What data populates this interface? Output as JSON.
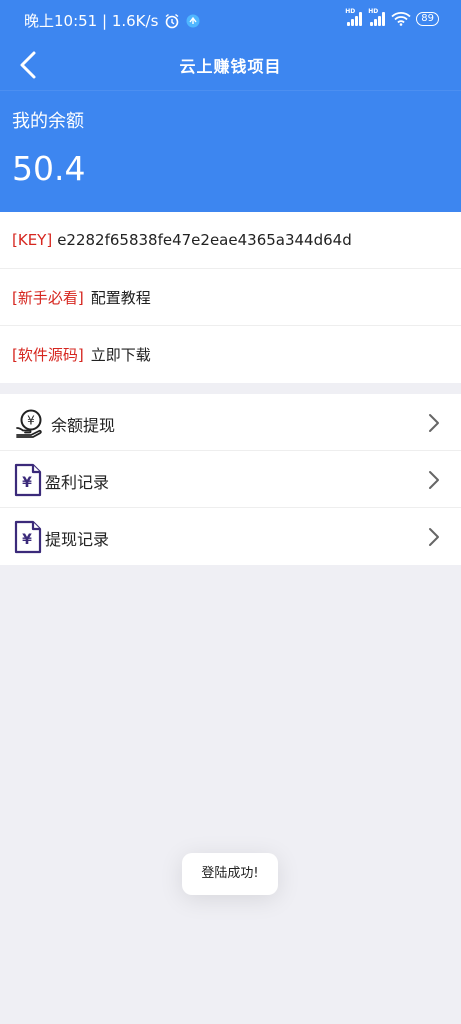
{
  "status_bar": {
    "time_speed": "晚上10:51 | 1.6K/s",
    "battery": "89"
  },
  "header": {
    "title": "云上赚钱项目"
  },
  "balance": {
    "label": "我的余额",
    "value": "50.4"
  },
  "info_rows": [
    {
      "tag": "[KEY]",
      "text": "e2282f65838fe47e2eae4365a344d64d"
    },
    {
      "tag": "[新手必看]",
      "text": "配置教程"
    },
    {
      "tag": "[软件源码]",
      "text": "立即下载"
    }
  ],
  "menu": [
    {
      "label": "余额提现",
      "icon": "withdraw-balance-icon"
    },
    {
      "label": "盈利记录",
      "icon": "profit-record-document-icon"
    },
    {
      "label": "提现记录",
      "icon": "withdraw-record-document-icon"
    }
  ],
  "toast": "登陆成功!",
  "colors": {
    "primary": "#3d86f0",
    "tag_red": "#d6261f",
    "icon_purple": "#3b2a7a"
  }
}
